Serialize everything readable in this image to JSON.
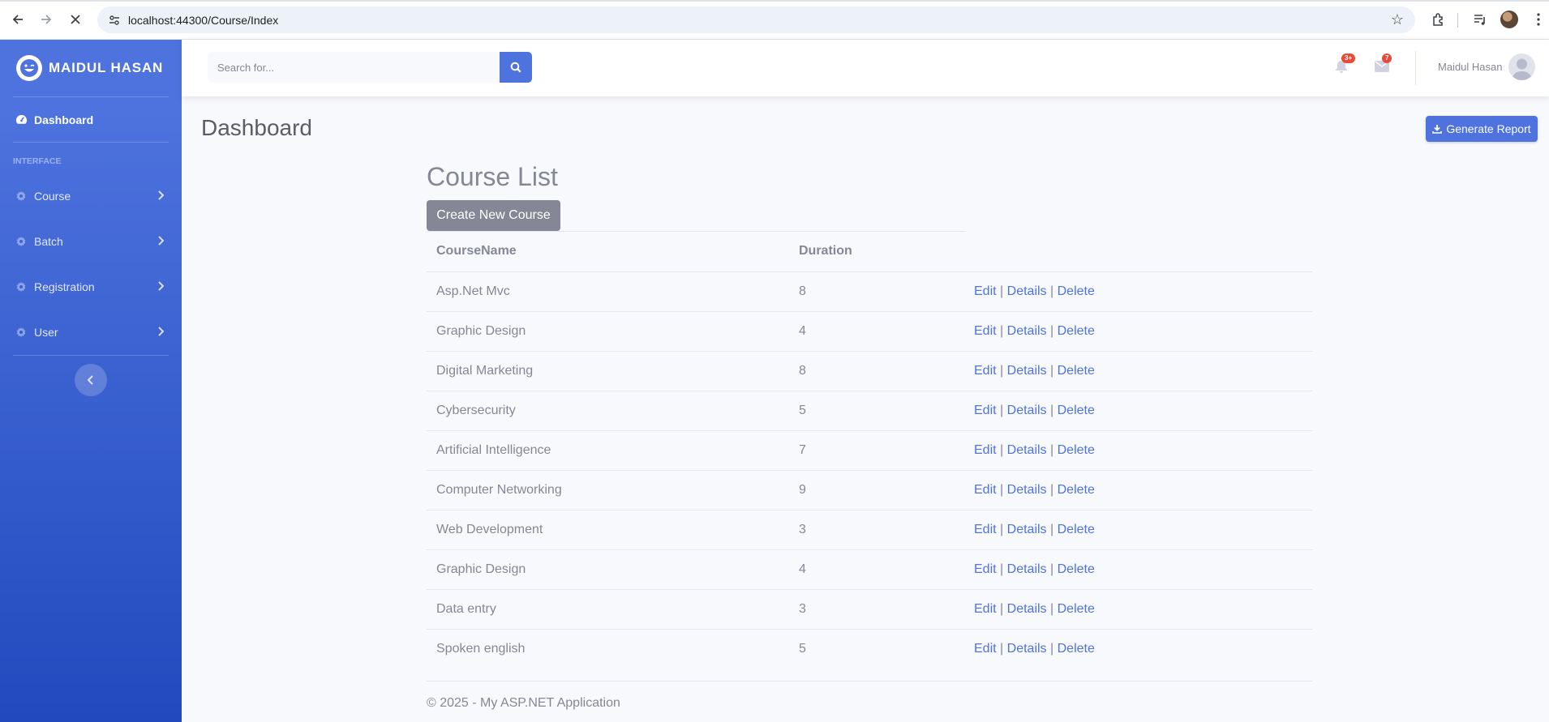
{
  "browser": {
    "url": "localhost:44300/Course/Index"
  },
  "sidebar": {
    "brand": "MAIDUL HASAN",
    "dashboard_label": "Dashboard",
    "section_heading": "INTERFACE",
    "items": [
      {
        "label": "Course"
      },
      {
        "label": "Batch"
      },
      {
        "label": "Registration"
      },
      {
        "label": "User"
      }
    ]
  },
  "topbar": {
    "search_placeholder": "Search for...",
    "alerts_badge": "3+",
    "messages_badge": "7",
    "user_name": "Maidul Hasan"
  },
  "main": {
    "page_title": "Dashboard",
    "generate_report_label": "Generate Report",
    "course_list_title": "Course List",
    "create_button_label": "Create New Course",
    "table": {
      "headers": [
        "CourseName",
        "Duration"
      ],
      "action_labels": {
        "edit": "Edit",
        "details": "Details",
        "delete": "Delete",
        "separator": "|"
      },
      "rows": [
        {
          "name": "Asp.Net Mvc",
          "duration": "8"
        },
        {
          "name": "Graphic Design",
          "duration": "4"
        },
        {
          "name": "Digital Marketing",
          "duration": "8"
        },
        {
          "name": "Cybersecurity",
          "duration": "5"
        },
        {
          "name": "Artificial Intelligence",
          "duration": "7"
        },
        {
          "name": "Computer Networking",
          "duration": "9"
        },
        {
          "name": "Web Development",
          "duration": "3"
        },
        {
          "name": "Graphic Design",
          "duration": "4"
        },
        {
          "name": "Data entry",
          "duration": "3"
        },
        {
          "name": "Spoken english",
          "duration": "5"
        }
      ]
    },
    "footer_text": "© 2025 - My ASP.NET Application"
  },
  "colors": {
    "primary": "#4e73df",
    "secondary": "#858796",
    "danger_badge": "#e74a3b"
  }
}
